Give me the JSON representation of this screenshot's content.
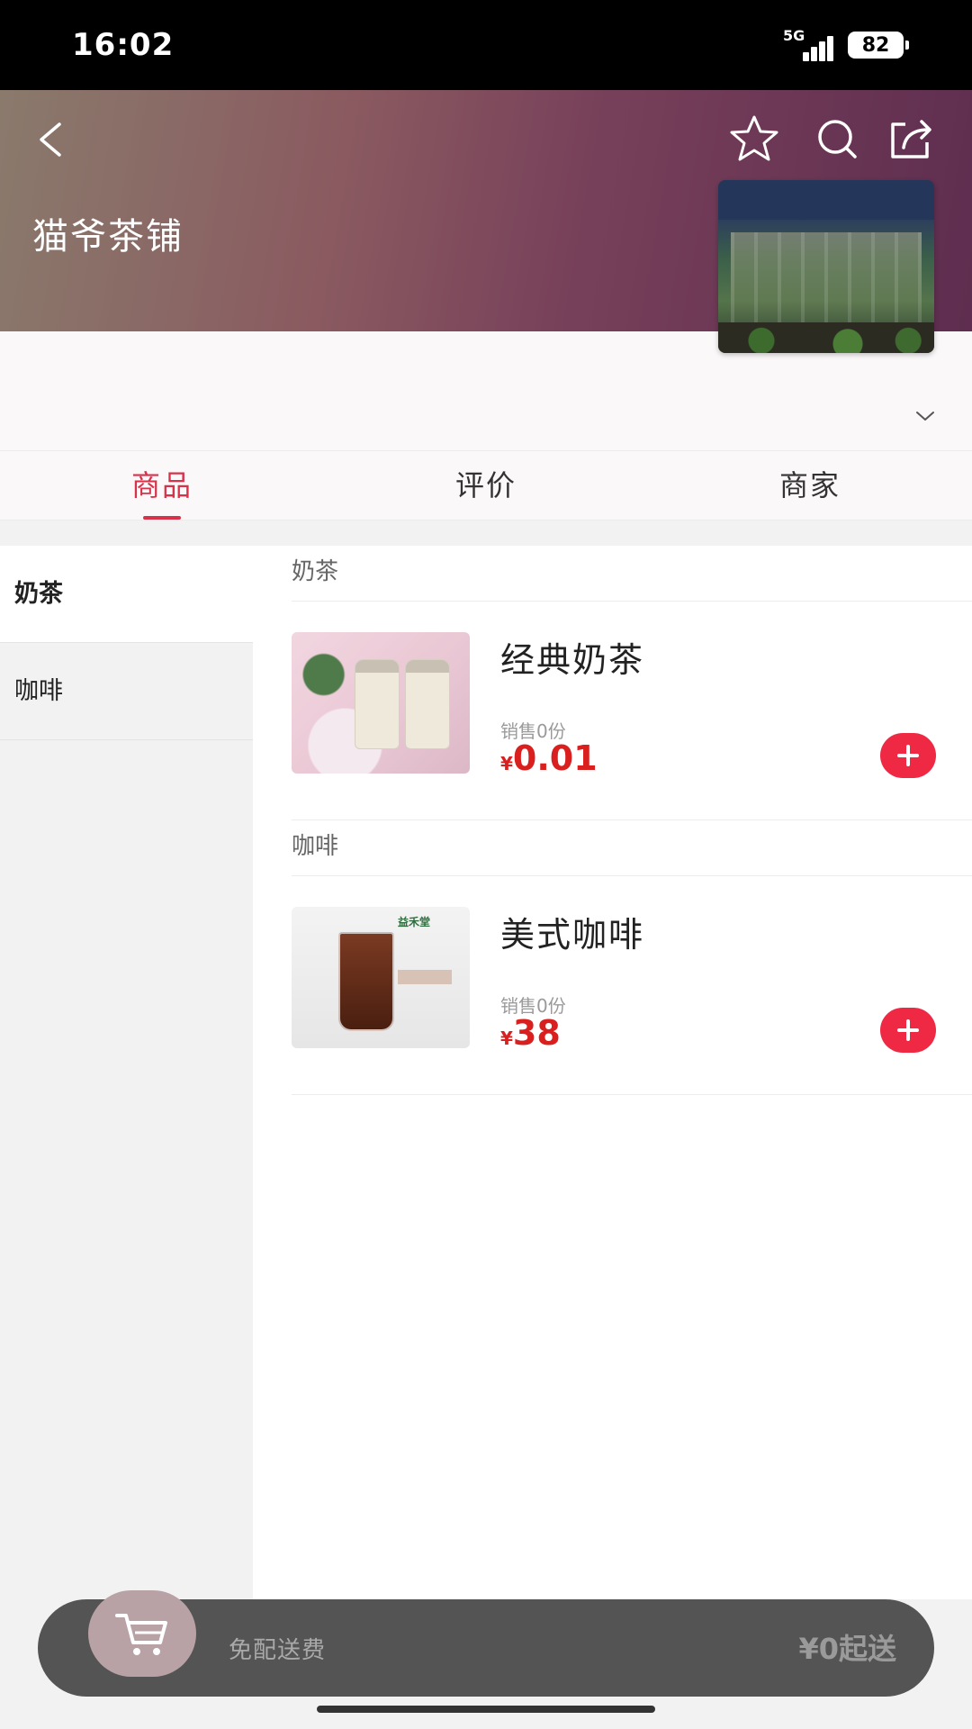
{
  "status_bar": {
    "time": "16:02",
    "network": "5G",
    "battery": "82"
  },
  "header": {
    "shop_name": "猫爷茶铺"
  },
  "tabs": [
    {
      "label": "商品",
      "active": true
    },
    {
      "label": "评价",
      "active": false
    },
    {
      "label": "商家",
      "active": false
    }
  ],
  "categories": [
    {
      "label": "奶茶",
      "active": true
    },
    {
      "label": "咖啡",
      "active": false
    }
  ],
  "sections": [
    {
      "title": "奶茶",
      "products": [
        {
          "name": "经典奶茶",
          "sales": "销售0份",
          "currency": "¥",
          "price": "0.01"
        }
      ]
    },
    {
      "title": "咖啡",
      "products": [
        {
          "name": "美式咖啡",
          "sales": "销售0份",
          "currency": "¥",
          "price": "38"
        }
      ]
    }
  ],
  "cart": {
    "delivery_text": "免配送费",
    "min_order_text": "¥0起送"
  },
  "colors": {
    "accent": "#d8324b",
    "price": "#d9201f",
    "add_button": "#ef2844",
    "cart_bar": "#545454"
  }
}
